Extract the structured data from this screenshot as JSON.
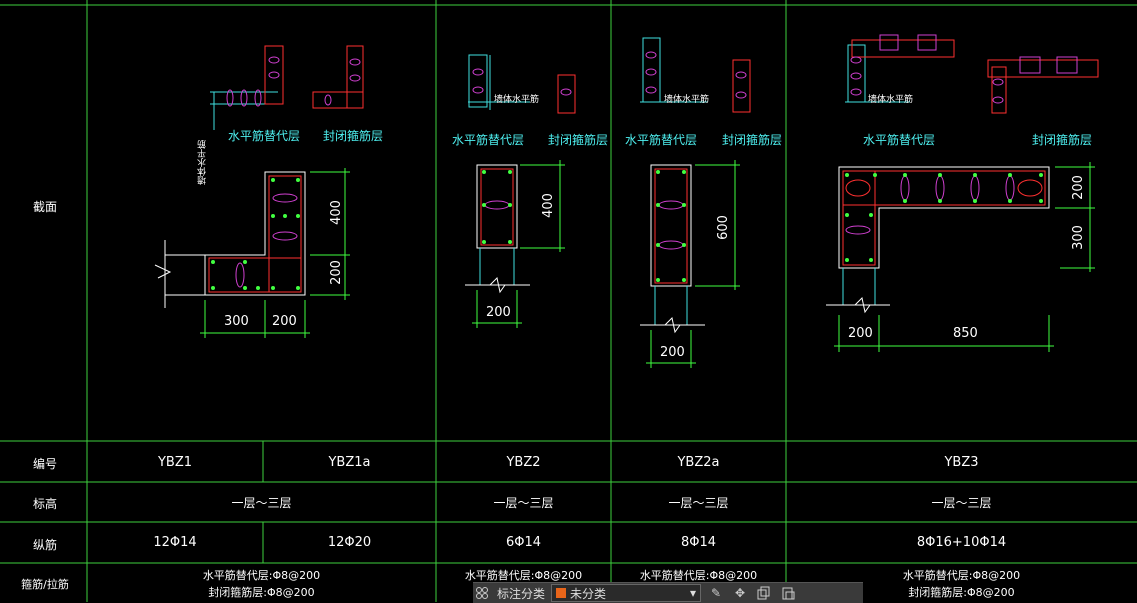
{
  "row_labels": {
    "section": "截面",
    "id": "编号",
    "elevation": "标高",
    "longitudinal": "纵筋",
    "stirrup": "箍筋/拉筋"
  },
  "ids": [
    "YBZ1",
    "YBZ1a",
    "YBZ2",
    "YBZ2a",
    "YBZ3"
  ],
  "elevations": [
    "一层～三层",
    "一层～三层",
    "一层～三层",
    "一层～三层"
  ],
  "longitudinal": [
    "12Φ14",
    "12Φ20",
    "6Φ14",
    "8Φ14",
    "8Φ16+10Φ14"
  ],
  "stirrup": {
    "c1_line1": "水平筋替代层:Φ8@200",
    "c1_line2": "封闭箍筋层:Φ8@200",
    "c2_line1": "水平筋替代层:Φ8@200",
    "c3_line1": "水平筋替代层:Φ8@200",
    "c4_line1": "水平筋替代层:Φ8@200",
    "c4_line2": "封闭箍筋层:Φ8@200"
  },
  "detail_labels": {
    "horiz": "水平筋替代层",
    "closed": "封闭箍筋层",
    "wall_horiz": "墙体水平筋"
  },
  "dims": {
    "d400a": "400",
    "d200a": "200",
    "d300a": "300",
    "d200b": "200",
    "d400b": "400",
    "d200c": "200",
    "d600": "600",
    "d200d": "200",
    "d200e": "200",
    "d300b": "300",
    "d200f": "200",
    "d850": "850"
  },
  "toolbar": {
    "category_label": "标注分类",
    "category_value": "未分类"
  },
  "colors": {
    "grid": "#3ecf3e",
    "concrete": "#ffffff",
    "stirrup": "#ff3030",
    "tie": "#d040d0",
    "bar": "#40ff40",
    "cyan": "#40e0e0"
  },
  "icons": [
    "layout-icon",
    "edit-icon",
    "move-icon",
    "copy-icon",
    "paste-icon",
    "chevron-down-icon"
  ]
}
